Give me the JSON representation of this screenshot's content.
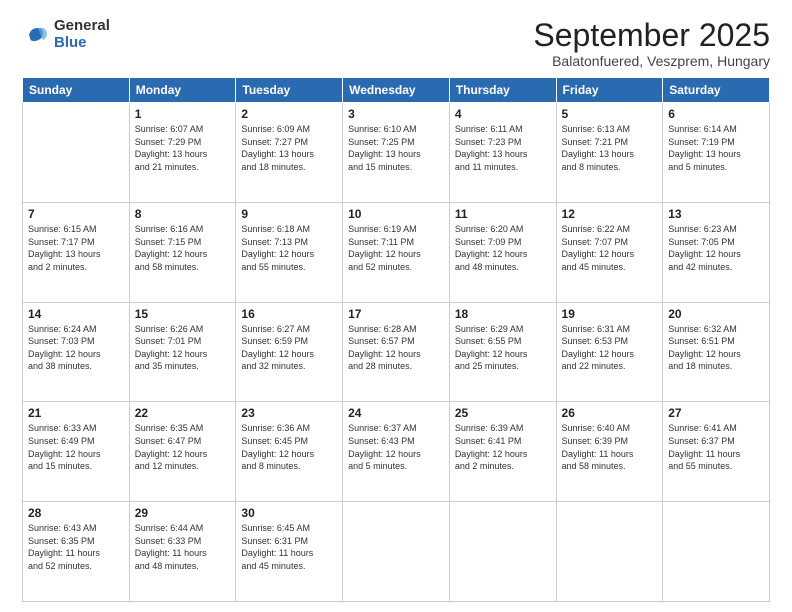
{
  "logo": {
    "general": "General",
    "blue": "Blue"
  },
  "header": {
    "month": "September 2025",
    "location": "Balatonfuered, Veszprem, Hungary"
  },
  "days_of_week": [
    "Sunday",
    "Monday",
    "Tuesday",
    "Wednesday",
    "Thursday",
    "Friday",
    "Saturday"
  ],
  "weeks": [
    [
      {
        "day": "",
        "info": ""
      },
      {
        "day": "1",
        "info": "Sunrise: 6:07 AM\nSunset: 7:29 PM\nDaylight: 13 hours\nand 21 minutes."
      },
      {
        "day": "2",
        "info": "Sunrise: 6:09 AM\nSunset: 7:27 PM\nDaylight: 13 hours\nand 18 minutes."
      },
      {
        "day": "3",
        "info": "Sunrise: 6:10 AM\nSunset: 7:25 PM\nDaylight: 13 hours\nand 15 minutes."
      },
      {
        "day": "4",
        "info": "Sunrise: 6:11 AM\nSunset: 7:23 PM\nDaylight: 13 hours\nand 11 minutes."
      },
      {
        "day": "5",
        "info": "Sunrise: 6:13 AM\nSunset: 7:21 PM\nDaylight: 13 hours\nand 8 minutes."
      },
      {
        "day": "6",
        "info": "Sunrise: 6:14 AM\nSunset: 7:19 PM\nDaylight: 13 hours\nand 5 minutes."
      }
    ],
    [
      {
        "day": "7",
        "info": "Sunrise: 6:15 AM\nSunset: 7:17 PM\nDaylight: 13 hours\nand 2 minutes."
      },
      {
        "day": "8",
        "info": "Sunrise: 6:16 AM\nSunset: 7:15 PM\nDaylight: 12 hours\nand 58 minutes."
      },
      {
        "day": "9",
        "info": "Sunrise: 6:18 AM\nSunset: 7:13 PM\nDaylight: 12 hours\nand 55 minutes."
      },
      {
        "day": "10",
        "info": "Sunrise: 6:19 AM\nSunset: 7:11 PM\nDaylight: 12 hours\nand 52 minutes."
      },
      {
        "day": "11",
        "info": "Sunrise: 6:20 AM\nSunset: 7:09 PM\nDaylight: 12 hours\nand 48 minutes."
      },
      {
        "day": "12",
        "info": "Sunrise: 6:22 AM\nSunset: 7:07 PM\nDaylight: 12 hours\nand 45 minutes."
      },
      {
        "day": "13",
        "info": "Sunrise: 6:23 AM\nSunset: 7:05 PM\nDaylight: 12 hours\nand 42 minutes."
      }
    ],
    [
      {
        "day": "14",
        "info": "Sunrise: 6:24 AM\nSunset: 7:03 PM\nDaylight: 12 hours\nand 38 minutes."
      },
      {
        "day": "15",
        "info": "Sunrise: 6:26 AM\nSunset: 7:01 PM\nDaylight: 12 hours\nand 35 minutes."
      },
      {
        "day": "16",
        "info": "Sunrise: 6:27 AM\nSunset: 6:59 PM\nDaylight: 12 hours\nand 32 minutes."
      },
      {
        "day": "17",
        "info": "Sunrise: 6:28 AM\nSunset: 6:57 PM\nDaylight: 12 hours\nand 28 minutes."
      },
      {
        "day": "18",
        "info": "Sunrise: 6:29 AM\nSunset: 6:55 PM\nDaylight: 12 hours\nand 25 minutes."
      },
      {
        "day": "19",
        "info": "Sunrise: 6:31 AM\nSunset: 6:53 PM\nDaylight: 12 hours\nand 22 minutes."
      },
      {
        "day": "20",
        "info": "Sunrise: 6:32 AM\nSunset: 6:51 PM\nDaylight: 12 hours\nand 18 minutes."
      }
    ],
    [
      {
        "day": "21",
        "info": "Sunrise: 6:33 AM\nSunset: 6:49 PM\nDaylight: 12 hours\nand 15 minutes."
      },
      {
        "day": "22",
        "info": "Sunrise: 6:35 AM\nSunset: 6:47 PM\nDaylight: 12 hours\nand 12 minutes."
      },
      {
        "day": "23",
        "info": "Sunrise: 6:36 AM\nSunset: 6:45 PM\nDaylight: 12 hours\nand 8 minutes."
      },
      {
        "day": "24",
        "info": "Sunrise: 6:37 AM\nSunset: 6:43 PM\nDaylight: 12 hours\nand 5 minutes."
      },
      {
        "day": "25",
        "info": "Sunrise: 6:39 AM\nSunset: 6:41 PM\nDaylight: 12 hours\nand 2 minutes."
      },
      {
        "day": "26",
        "info": "Sunrise: 6:40 AM\nSunset: 6:39 PM\nDaylight: 11 hours\nand 58 minutes."
      },
      {
        "day": "27",
        "info": "Sunrise: 6:41 AM\nSunset: 6:37 PM\nDaylight: 11 hours\nand 55 minutes."
      }
    ],
    [
      {
        "day": "28",
        "info": "Sunrise: 6:43 AM\nSunset: 6:35 PM\nDaylight: 11 hours\nand 52 minutes."
      },
      {
        "day": "29",
        "info": "Sunrise: 6:44 AM\nSunset: 6:33 PM\nDaylight: 11 hours\nand 48 minutes."
      },
      {
        "day": "30",
        "info": "Sunrise: 6:45 AM\nSunset: 6:31 PM\nDaylight: 11 hours\nand 45 minutes."
      },
      {
        "day": "",
        "info": ""
      },
      {
        "day": "",
        "info": ""
      },
      {
        "day": "",
        "info": ""
      },
      {
        "day": "",
        "info": ""
      }
    ]
  ]
}
